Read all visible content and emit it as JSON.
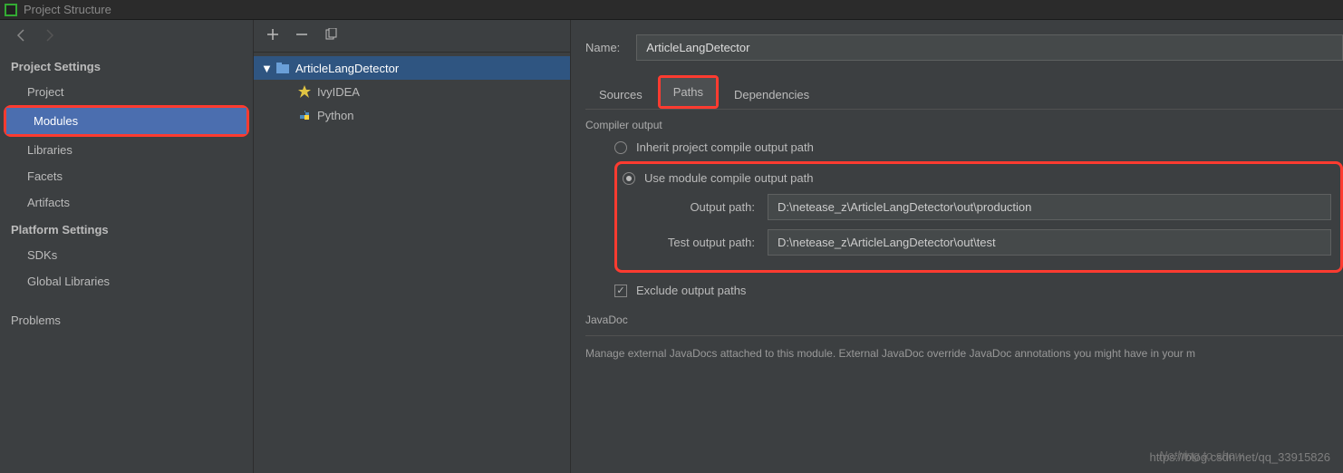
{
  "window": {
    "title": "Project Structure"
  },
  "nav": {
    "sections": [
      {
        "title": "Project Settings",
        "items": [
          "Project",
          "Modules",
          "Libraries",
          "Facets",
          "Artifacts"
        ],
        "selected": "Modules"
      },
      {
        "title": "Platform Settings",
        "items": [
          "SDKs",
          "Global Libraries"
        ]
      }
    ],
    "problems": "Problems"
  },
  "tree": {
    "module": "ArticleLangDetector",
    "children": [
      "IvyIDEA",
      "Python"
    ]
  },
  "details": {
    "name_label": "Name:",
    "name_value": "ArticleLangDetector",
    "tabs": [
      "Sources",
      "Paths",
      "Dependencies"
    ],
    "active_tab": "Paths",
    "compiler_title": "Compiler output",
    "radio_inherit": "Inherit project compile output path",
    "radio_module": "Use module compile output path",
    "output_label": "Output path:",
    "output_value": "D:\\netease_z\\ArticleLangDetector\\out\\production",
    "test_label": "Test output path:",
    "test_value": "D:\\netease_z\\ArticleLangDetector\\out\\test",
    "exclude_label": "Exclude output paths",
    "javadoc_title": "JavaDoc",
    "javadoc_desc": "Manage external JavaDocs attached to this module. External JavaDoc override JavaDoc annotations you might have in your m",
    "nothing": "Nothing to show"
  },
  "watermark": "https://blog.csdn.net/qq_33915826"
}
